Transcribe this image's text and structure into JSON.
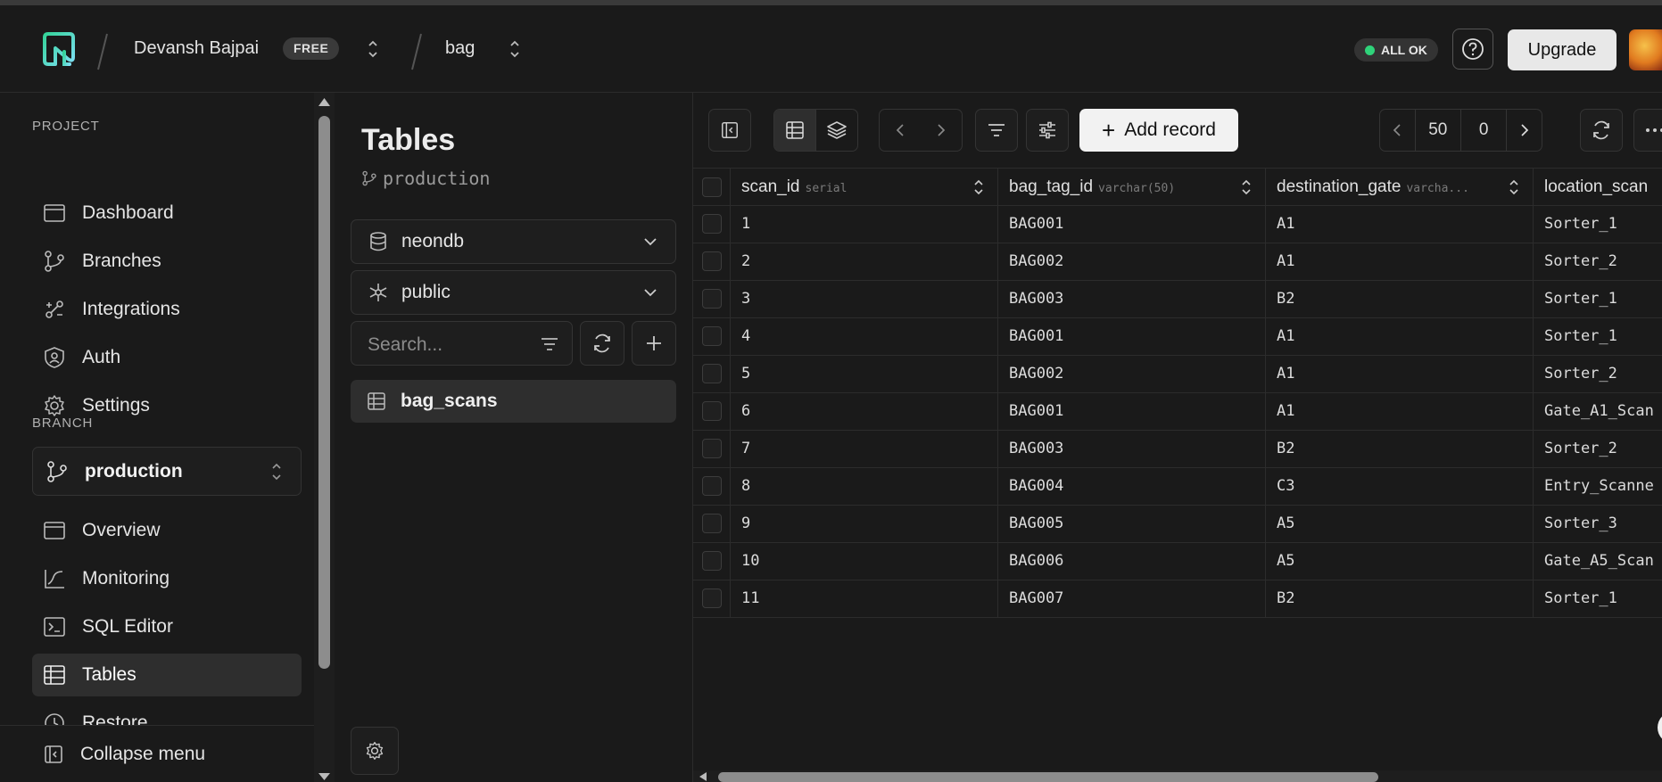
{
  "header": {
    "org_name": "Devansh Bajpai",
    "plan_badge": "FREE",
    "project_name": "bag",
    "status_label": "ALL OK",
    "upgrade_label": "Upgrade"
  },
  "sidebar": {
    "project_label": "PROJECT",
    "project_items": [
      {
        "label": "Dashboard",
        "icon": "dashboard-icon"
      },
      {
        "label": "Branches",
        "icon": "branch-icon"
      },
      {
        "label": "Integrations",
        "icon": "integrations-icon"
      },
      {
        "label": "Auth",
        "icon": "shield-icon"
      },
      {
        "label": "Settings",
        "icon": "gear-icon"
      }
    ],
    "branch_label": "BRANCH",
    "branch_selected": "production",
    "branch_items": [
      {
        "label": "Overview",
        "icon": "overview-icon"
      },
      {
        "label": "Monitoring",
        "icon": "chart-line-icon"
      },
      {
        "label": "SQL Editor",
        "icon": "terminal-icon"
      },
      {
        "label": "Tables",
        "icon": "table-icon",
        "active": true
      },
      {
        "label": "Restore",
        "icon": "clock-icon"
      }
    ],
    "collapse_label": "Collapse menu"
  },
  "tables_panel": {
    "title": "Tables",
    "branch": "production",
    "database": "neondb",
    "schema": "public",
    "search_placeholder": "Search...",
    "tables": [
      "bag_scans"
    ]
  },
  "toolbar": {
    "add_record_label": "Add record",
    "page_size": "50",
    "offset": "0"
  },
  "grid": {
    "columns": [
      {
        "name": "scan_id",
        "type": "serial"
      },
      {
        "name": "bag_tag_id",
        "type": "varchar(50)"
      },
      {
        "name": "destination_gate",
        "type": "varcha..."
      },
      {
        "name": "location_scan",
        "type": ""
      }
    ],
    "rows": [
      [
        "1",
        "BAG001",
        "A1",
        "Sorter_1"
      ],
      [
        "2",
        "BAG002",
        "A1",
        "Sorter_2"
      ],
      [
        "3",
        "BAG003",
        "B2",
        "Sorter_1"
      ],
      [
        "4",
        "BAG001",
        "A1",
        "Sorter_1"
      ],
      [
        "5",
        "BAG002",
        "A1",
        "Sorter_2"
      ],
      [
        "6",
        "BAG001",
        "A1",
        "Gate_A1_Scan"
      ],
      [
        "7",
        "BAG003",
        "B2",
        "Sorter_2"
      ],
      [
        "8",
        "BAG004",
        "C3",
        "Entry_Scanne"
      ],
      [
        "9",
        "BAG005",
        "A5",
        "Sorter_3"
      ],
      [
        "10",
        "BAG006",
        "A5",
        "Gate_A5_Scan"
      ],
      [
        "11",
        "BAG007",
        "B2",
        "Sorter_1"
      ]
    ]
  },
  "colors": {
    "background": "#1a1a1a",
    "brand_gradient_start": "#34d399",
    "brand_gradient_end": "#7ee0f5",
    "status_ok": "#2fd37a",
    "primary_button": "#f2f2f2"
  }
}
